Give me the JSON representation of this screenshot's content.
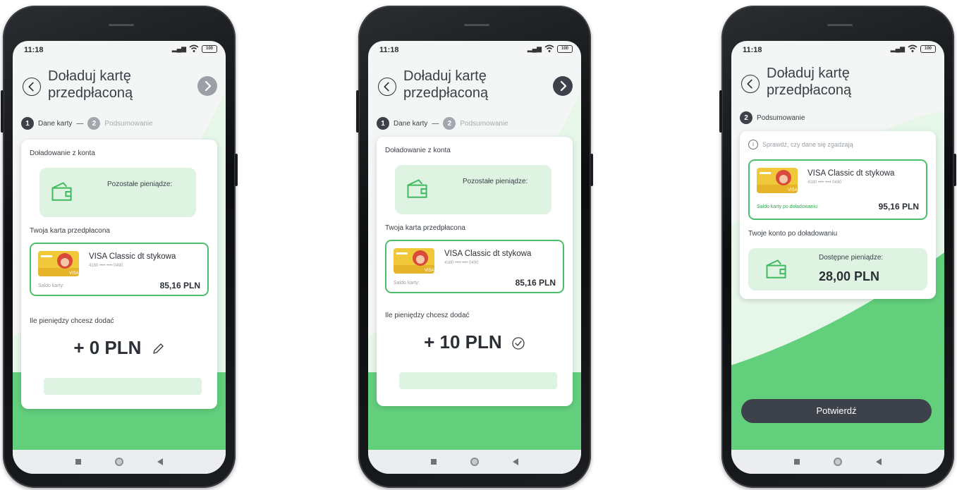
{
  "status": {
    "time": "11:18",
    "battery": "100"
  },
  "title": "Doładuj kartę przedpłaconą",
  "steps": {
    "step1_num": "1",
    "step1_label": "Dane karty",
    "step2_num": "2",
    "step2_label": "Podsumowanie"
  },
  "form": {
    "from_account_label": "Doładowanie z konta",
    "remaining_label": "Pozostałe pieniądze:",
    "prepaid_card_label": "Twoja karta przedpłacona",
    "card_name": "VISA Classic dt stykowa",
    "card_number": "4180 •••• •••• 0490",
    "card_balance_label": "Saldo karty:",
    "card_balance": "85,16 PLN",
    "how_much_label": "Ile pieniędzy chcesz dodać",
    "amount_empty": "+ 0  PLN",
    "amount_filled": "+ 10 PLN"
  },
  "summary": {
    "check_info": "Sprawdź, czy dane się zgadzają",
    "card_name": "VISA Classic dt stykowa",
    "card_number": "4180 •••• •••• 0490",
    "balance_after_label": "Saldo karty po doładowaniu",
    "balance_after": "95,16 PLN",
    "account_after_label": "Twoje konto po doładowaniu",
    "available_label": "Dostępne pieniądze:",
    "available_amount": "28,00 PLN",
    "confirm_label": "Potwierdź"
  },
  "colors": {
    "accent_green": "#4bbf69",
    "light_green": "#dff3e3",
    "dark": "#3d4149"
  },
  "icons": [
    "back-icon",
    "next-icon",
    "wallet-icon",
    "pencil-icon",
    "check-circle-icon",
    "info-icon",
    "wifi-icon"
  ]
}
